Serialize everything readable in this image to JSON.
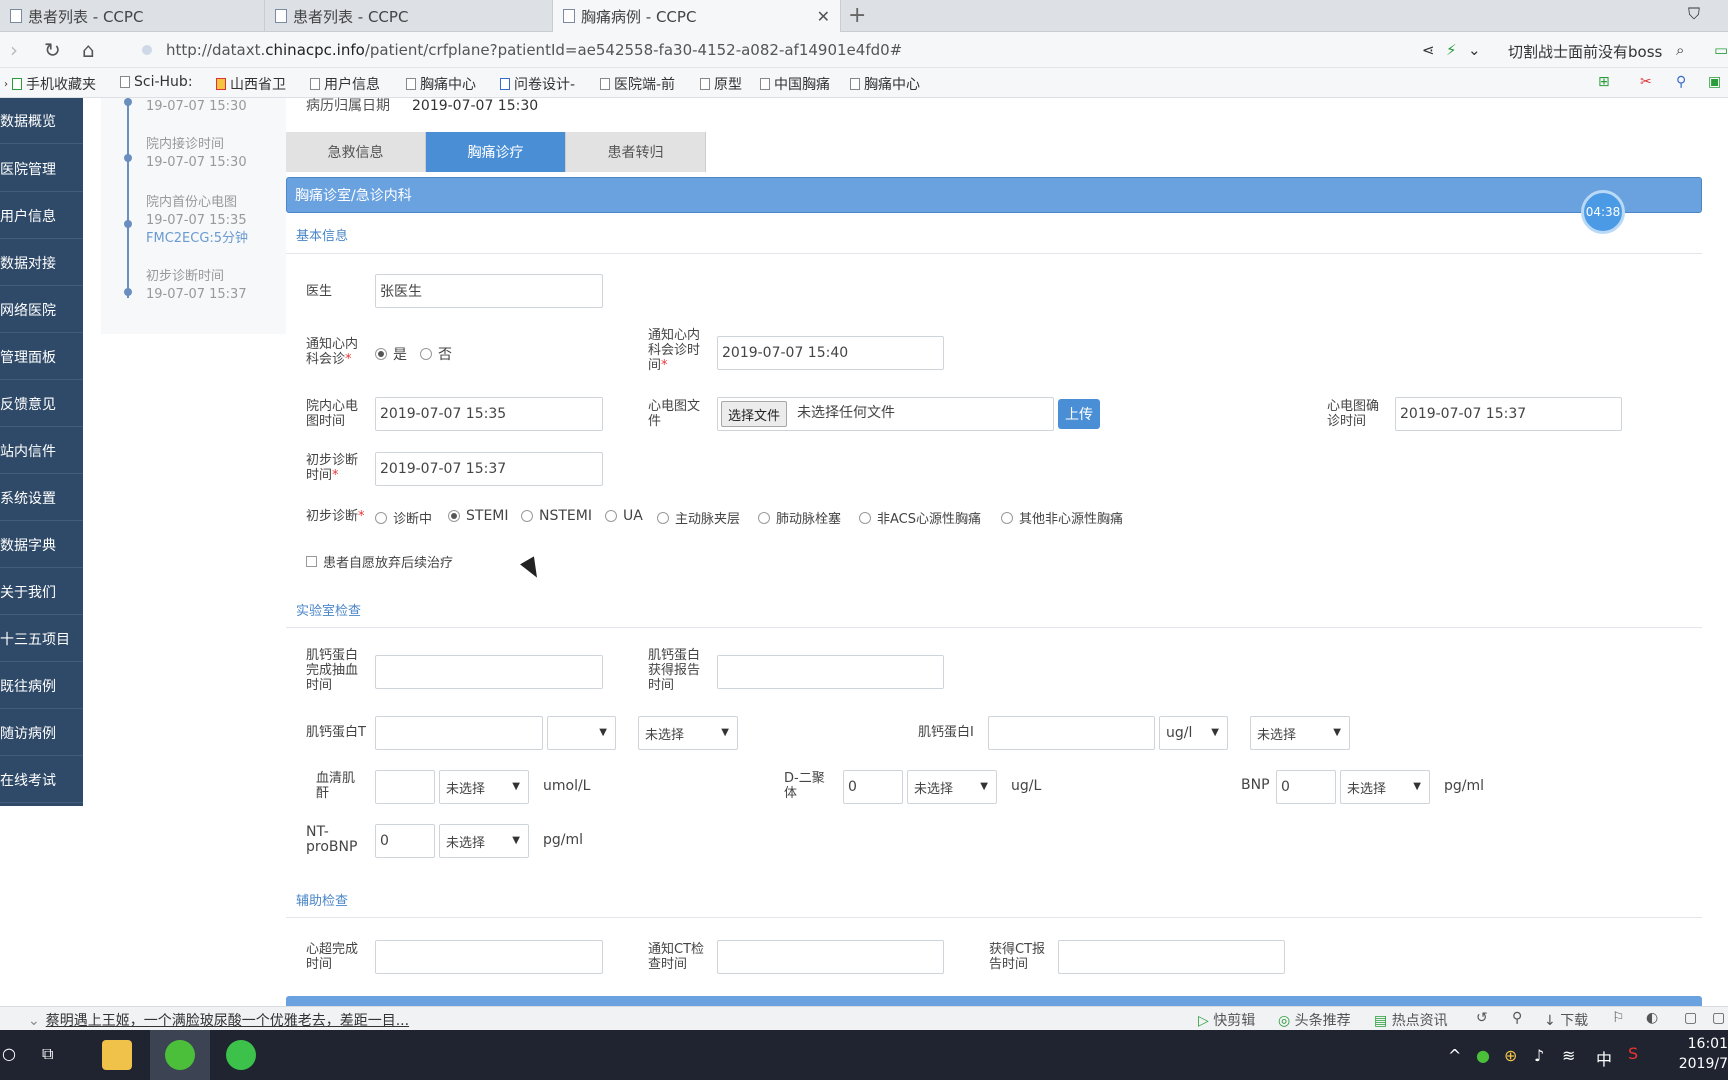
{
  "browser": {
    "tabs": [
      {
        "title": "患者列表 - CCPC"
      },
      {
        "title": "患者列表 - CCPC"
      },
      {
        "title": "胸痛病例 - CCPC"
      }
    ],
    "url_prefix": "http://dataxt.",
    "url_domain": "chinacpc.info",
    "url_path": "/patient/crfplane?patientId=ae542558-fa30-4152-a082-af14901e4fd0#",
    "search_hint": "切割战士面前没有boss",
    "bookmarks": [
      "手机收藏夹",
      "Sci-Hub:",
      "山西省卫",
      "用户信息",
      "胸痛中心",
      "问卷设计-",
      "医院端-前",
      "原型",
      "中国胸痛",
      "胸痛中心"
    ]
  },
  "sidebar": {
    "items": [
      "数据概览",
      "医院管理",
      "用户信息",
      "数据对接",
      "网络医院",
      "管理面板",
      "反馈意见",
      "站内信件",
      "系统设置",
      "数据字典",
      "关于我们",
      "十三五项目",
      "既往病例",
      "随访病例",
      "在线考试"
    ]
  },
  "timeline": {
    "items": [
      {
        "title": "",
        "time": "19-07-07 15:30",
        "extra": ""
      },
      {
        "title": "院内接诊时间",
        "time": "19-07-07 15:30",
        "extra": ""
      },
      {
        "title": "院内首份心电图",
        "time": "19-07-07 15:35",
        "extra": "FMC2ECG:5分钟"
      },
      {
        "title": "初步诊断时间",
        "time": "19-07-07 15:37",
        "extra": ""
      }
    ]
  },
  "record": {
    "label": "病历归属日期",
    "value": "2019-07-07 15:30"
  },
  "tabs": [
    "急救信息",
    "胸痛诊疗",
    "患者转归"
  ],
  "section_title": "胸痛诊室/急诊内科",
  "timer": "04:38",
  "basic": {
    "heading": "基本信息",
    "doctor_label": "医生",
    "doctor_value": "张医生",
    "notify_label_1": "通知心内",
    "notify_label_2": "科会诊",
    "notify_yes": "是",
    "notify_no": "否",
    "notify_time_label_1": "通知心内",
    "notify_time_label_2": "科会诊时",
    "notify_time_label_3": "间",
    "notify_time_value": "2019-07-07 15:40",
    "ecg_time_label_1": "院内心电",
    "ecg_time_label_2": "图时间",
    "ecg_time_value": "2019-07-07 15:35",
    "ecg_file_label_1": "心电图文",
    "ecg_file_label_2": "件",
    "file_button": "选择文件",
    "file_none": "未选择任何文件",
    "upload_button": "上传",
    "ecg_confirm_label_1": "心电图确",
    "ecg_confirm_label_2": "诊时间",
    "ecg_confirm_value": "2019-07-07 15:37",
    "diag_time_label_1": "初步诊断",
    "diag_time_label_2": "时间",
    "diag_time_value": "2019-07-07 15:37",
    "diag_label": "初步诊断",
    "diag_options": [
      "诊断中",
      "STEMI",
      "NSTEMI",
      "UA",
      "主动脉夹层",
      "肺动脉栓塞",
      "非ACS心源性胸痛",
      "其他非心源性胸痛"
    ],
    "diag_selected": "STEMI",
    "abandon_label": "患者自愿放弃后续治疗"
  },
  "lab": {
    "heading": "实验室检查",
    "troponin_draw_1": "肌钙蛋白",
    "troponin_draw_2": "完成抽血",
    "troponin_draw_3": "时间",
    "troponin_report_1": "肌钙蛋白",
    "troponin_report_2": "获得报告",
    "troponin_report_3": "时间",
    "troponin_t_label": "肌钙蛋白T",
    "troponin_t_unit": "",
    "troponin_t_status": "未选择",
    "troponin_i_label": "肌钙蛋白I",
    "troponin_i_unit": "ug/l",
    "troponin_i_status": "未选择",
    "creatinine_label_1": "血清肌",
    "creatinine_label_2": "酐",
    "creatinine_status": "未选择",
    "creatinine_unit": "umol/L",
    "ddimer_label_1": "D-二聚",
    "ddimer_label_2": "体",
    "ddimer_value": "0",
    "ddimer_status": "未选择",
    "ddimer_unit": "ug/L",
    "bnp_label": "BNP",
    "bnp_value": "0",
    "bnp_status": "未选择",
    "bnp_unit": "pg/ml",
    "ntprobnp_label_1": "NT-",
    "ntprobnp_label_2": "proBNP",
    "ntprobnp_value": "0",
    "ntprobnp_status": "未选择",
    "ntprobnp_unit": "pg/ml"
  },
  "aux": {
    "heading": "辅助检查",
    "echo_label_1": "心超完成",
    "echo_label_2": "时间",
    "ct_notify_label_1": "通知CT检",
    "ct_notify_label_2": "查时间",
    "ct_report_label_1": "获得CT报",
    "ct_report_label_2": "告时间"
  },
  "statusbar": {
    "news": "蔡明遇上王姬，一个满脸玻尿酸一个优雅老去，差距一目...",
    "items": [
      "快剪辑",
      "头条推荐",
      "热点资讯",
      "下载"
    ]
  },
  "taskbar": {
    "ime": "中",
    "time": "16:01",
    "date": "2019/7"
  },
  "colors": {
    "primary": "#4a8fd6",
    "section": "#6aa2e0",
    "sidebar": "#2f4a68"
  }
}
